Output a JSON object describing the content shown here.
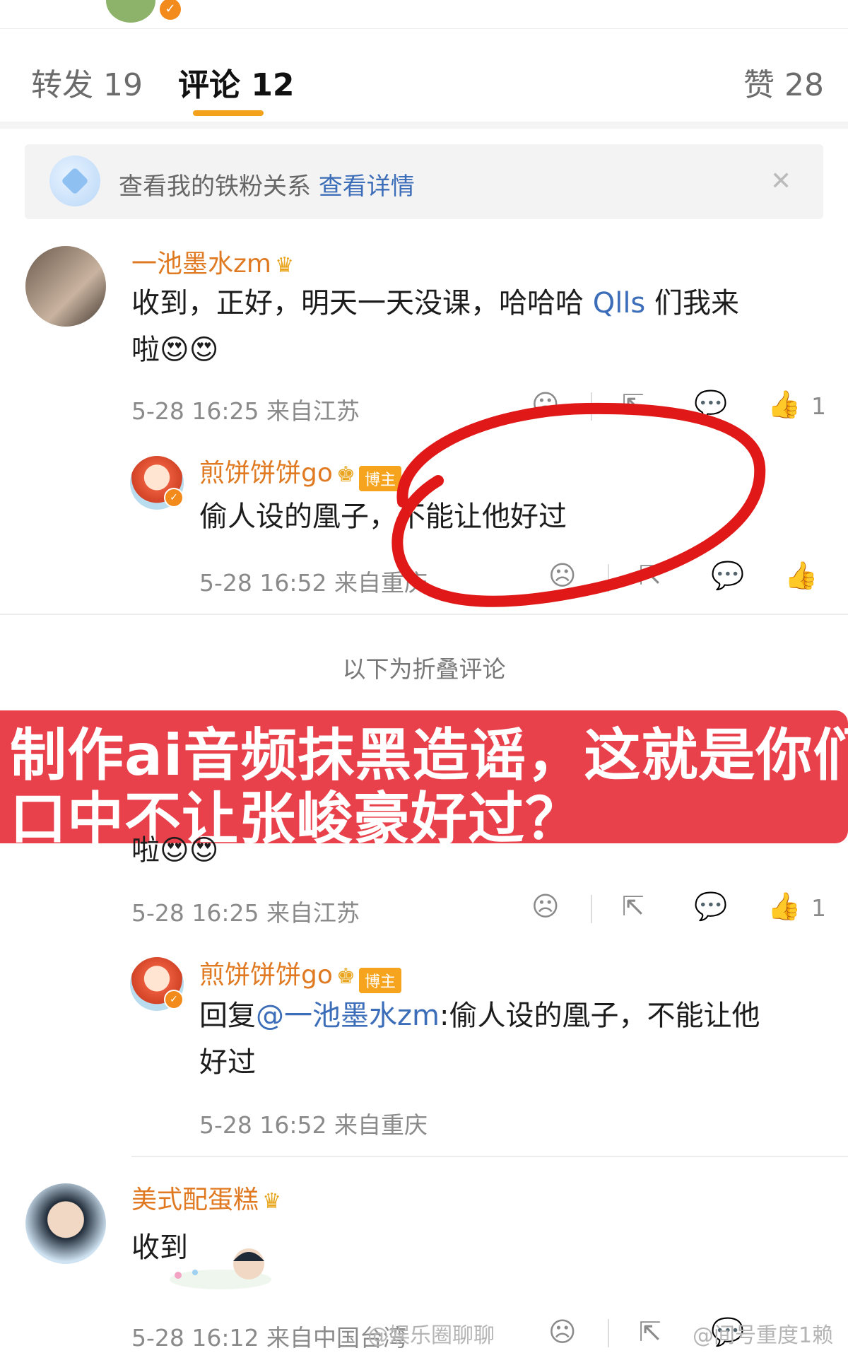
{
  "tabs": [
    {
      "label": "转发 19"
    },
    {
      "label": "评论 12"
    },
    {
      "label": "赞 28"
    }
  ],
  "banner": {
    "text": "查看我的铁粉关系",
    "link": "查看详情",
    "close": "✕"
  },
  "comments": [
    {
      "user": "一池墨水zm",
      "text_line1": "收到，正好，明天一天没课，哈哈哈 ",
      "mention": "Qlls",
      "text_line1_end": " 们我来",
      "text_line2": "啦😍😍",
      "meta": "5-28 16:25  来自江苏",
      "likes": "1"
    },
    {
      "user": "煎饼饼饼go",
      "tag": "博主",
      "text": "偷人设的凰子，不能让他好过",
      "meta": "5-28 16:52  来自重庆"
    },
    {
      "text": "啦😍😍",
      "meta": "5-28 16:25  来自江苏",
      "likes": "1"
    },
    {
      "user": "煎饼饼饼go",
      "tag": "博主",
      "reply_prefix": "回复",
      "reply_mention": "@一池墨水zm",
      "reply_text": ":偷人设的凰子，不能让他",
      "reply_line2": "好过",
      "meta": "5-28 16:52  来自重庆"
    },
    {
      "user": "美式配蛋糕",
      "text": "收到",
      "meta": "5-28 16:12  来自中国台湾"
    }
  ],
  "fold_label": "以下为折叠评论",
  "overlay": {
    "line1": "制作ai音频抹黑造谣，这就是你们",
    "line2": "口中不让张峻豪好过？"
  },
  "watermarks": [
    "@娱乐圈聊聊",
    "@间号重度1赖"
  ],
  "colors": {
    "accent": "#f4a21c",
    "username": "#e07a22",
    "link": "#3c6db8",
    "overlay": "#e9414c"
  }
}
